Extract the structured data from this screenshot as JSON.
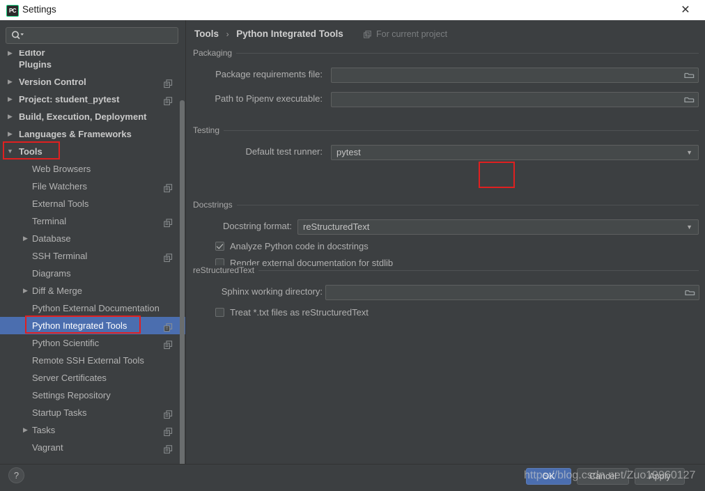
{
  "window": {
    "title": "Settings",
    "app_icon": "pycharm-icon",
    "close_label": "✕"
  },
  "sidebar": {
    "search": {
      "placeholder": "",
      "value": "",
      "icon": "search-icon"
    },
    "items": [
      {
        "label": "Editor",
        "level": 0,
        "bold": true,
        "arrow": "▶",
        "copy": false,
        "selected": false,
        "clipped": true
      },
      {
        "label": "Plugins",
        "level": 0,
        "bold": true,
        "arrow": "",
        "copy": false,
        "selected": false
      },
      {
        "label": "Version Control",
        "level": 0,
        "bold": true,
        "arrow": "▶",
        "copy": true,
        "selected": false
      },
      {
        "label": "Project: student_pytest",
        "level": 0,
        "bold": true,
        "arrow": "▶",
        "copy": true,
        "selected": false
      },
      {
        "label": "Build, Execution, Deployment",
        "level": 0,
        "bold": true,
        "arrow": "▶",
        "copy": false,
        "selected": false
      },
      {
        "label": "Languages & Frameworks",
        "level": 0,
        "bold": true,
        "arrow": "▶",
        "copy": false,
        "selected": false
      },
      {
        "label": "Tools",
        "level": 0,
        "bold": true,
        "arrow": "▼",
        "copy": false,
        "selected": false,
        "boxed": true
      },
      {
        "label": "Web Browsers",
        "level": 1,
        "bold": false,
        "arrow": "",
        "copy": false,
        "selected": false
      },
      {
        "label": "File Watchers",
        "level": 1,
        "bold": false,
        "arrow": "",
        "copy": true,
        "selected": false
      },
      {
        "label": "External Tools",
        "level": 1,
        "bold": false,
        "arrow": "",
        "copy": false,
        "selected": false
      },
      {
        "label": "Terminal",
        "level": 1,
        "bold": false,
        "arrow": "",
        "copy": true,
        "selected": false
      },
      {
        "label": "Database",
        "level": 1,
        "bold": false,
        "arrow": "▶",
        "copy": false,
        "selected": false
      },
      {
        "label": "SSH Terminal",
        "level": 1,
        "bold": false,
        "arrow": "",
        "copy": true,
        "selected": false
      },
      {
        "label": "Diagrams",
        "level": 1,
        "bold": false,
        "arrow": "",
        "copy": false,
        "selected": false
      },
      {
        "label": "Diff & Merge",
        "level": 1,
        "bold": false,
        "arrow": "▶",
        "copy": false,
        "selected": false
      },
      {
        "label": "Python External Documentation",
        "level": 1,
        "bold": false,
        "arrow": "",
        "copy": false,
        "selected": false
      },
      {
        "label": "Python Integrated Tools",
        "level": 1,
        "bold": false,
        "arrow": "",
        "copy": true,
        "selected": true,
        "boxed": true
      },
      {
        "label": "Python Scientific",
        "level": 1,
        "bold": false,
        "arrow": "",
        "copy": true,
        "selected": false
      },
      {
        "label": "Remote SSH External Tools",
        "level": 1,
        "bold": false,
        "arrow": "",
        "copy": false,
        "selected": false
      },
      {
        "label": "Server Certificates",
        "level": 1,
        "bold": false,
        "arrow": "",
        "copy": false,
        "selected": false
      },
      {
        "label": "Settings Repository",
        "level": 1,
        "bold": false,
        "arrow": "",
        "copy": false,
        "selected": false
      },
      {
        "label": "Startup Tasks",
        "level": 1,
        "bold": false,
        "arrow": "",
        "copy": true,
        "selected": false
      },
      {
        "label": "Tasks",
        "level": 1,
        "bold": false,
        "arrow": "▶",
        "copy": true,
        "selected": false
      },
      {
        "label": "Vagrant",
        "level": 1,
        "bold": false,
        "arrow": "",
        "copy": true,
        "selected": false
      }
    ]
  },
  "breadcrumb": {
    "parent": "Tools",
    "separator": "›",
    "current": "Python Integrated Tools",
    "scope_label": "For current project",
    "scope_icon": "project-scope-icon"
  },
  "sections": {
    "packaging": {
      "title": "Packaging",
      "fields": [
        {
          "label": "Package requirements file:",
          "value": "",
          "browse_icon": "folder-icon"
        },
        {
          "label": "Path to Pipenv executable:",
          "value": "",
          "browse_icon": "folder-icon"
        }
      ]
    },
    "testing": {
      "title": "Testing",
      "field_label": "Default test runner:",
      "value": "pytest",
      "dropdown_icon": "chevron-down-icon"
    },
    "docstrings": {
      "title": "Docstrings",
      "field_label": "Docstring format:",
      "value": "reStructuredText",
      "dropdown_icon": "chevron-down-icon",
      "checkboxes": [
        {
          "label": "Analyze Python code in docstrings",
          "checked": true
        },
        {
          "label": "Render external documentation for stdlib",
          "checked": false
        }
      ]
    },
    "restructuredtext": {
      "title": "reStructuredText",
      "field_label": "Sphinx working directory:",
      "value": "",
      "browse_icon": "folder-icon",
      "checkboxes": [
        {
          "label": "Treat *.txt files as reStructuredText",
          "checked": false
        }
      ]
    }
  },
  "footer": {
    "help_label": "?",
    "buttons": [
      {
        "label": "OK",
        "primary": true
      },
      {
        "label": "Cancel",
        "primary": false
      },
      {
        "label": "Apply",
        "primary": false
      }
    ],
    "watermark": "https://blog.csdn.net/Zuo19960127"
  },
  "colors": {
    "background": "#3c3f41",
    "selection": "#4b6eaf",
    "annotation": "#e02020",
    "titlebar": "#ffffff"
  }
}
